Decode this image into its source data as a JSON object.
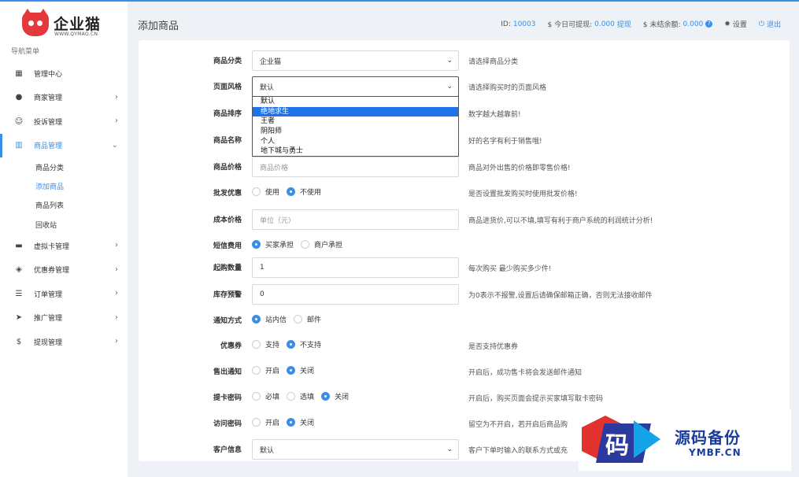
{
  "logo": {
    "name": "企业猫",
    "sub": "WWW.QYMAO.CN"
  },
  "nav": {
    "title": "导航菜单",
    "items": [
      {
        "label": "管理中心",
        "icon": "dashboard-icon",
        "chev": ""
      },
      {
        "label": "商家管理",
        "icon": "user-icon",
        "chev": "›"
      },
      {
        "label": "投诉管理",
        "icon": "face-icon",
        "chev": "›"
      },
      {
        "label": "商品管理",
        "icon": "shop-icon",
        "chev": "⌄"
      },
      {
        "label": "虚拟卡管理",
        "icon": "card-icon",
        "chev": "›"
      },
      {
        "label": "优惠券管理",
        "icon": "tag-icon",
        "chev": "›"
      },
      {
        "label": "订单管理",
        "icon": "list-icon",
        "chev": "›"
      },
      {
        "label": "推广管理",
        "icon": "send-icon",
        "chev": "›"
      },
      {
        "label": "提现管理",
        "icon": "dollar-icon",
        "chev": "›"
      }
    ],
    "sub_items": [
      "商品分类",
      "添加商品",
      "商品列表",
      "回收站"
    ]
  },
  "header": {
    "title": "添加商品",
    "id_label": "ID:",
    "id_value": "10003",
    "withdraw_label": "$ 今日可提现:",
    "withdraw_value": "0.000",
    "withdraw_link": "提现",
    "unsettled_label": "$ 未结余额:",
    "unsettled_value": "0.000",
    "settings": "设置",
    "logout": "退出"
  },
  "form": {
    "category": {
      "label": "商品分类",
      "value": "企业猫",
      "hint": "请选择商品分类"
    },
    "style": {
      "label": "页面风格",
      "value": "默认",
      "hint": "请选择购买时的页面风格",
      "options": [
        "默认",
        "绝地求生",
        "王者",
        "阴阳师",
        "个人",
        "地下城与勇士"
      ],
      "highlighted": "绝地求生"
    },
    "sort": {
      "label": "商品排序",
      "hint": "数字越大越靠前!"
    },
    "name": {
      "label": "商品名称",
      "hint": "好的名字有利于销售哦!"
    },
    "price": {
      "label": "商品价格",
      "placeholder": "商品价格",
      "hint": "商品对外出售的价格即零售价格!"
    },
    "wholesale": {
      "label": "批发优惠",
      "options": [
        "使用",
        "不使用"
      ],
      "selected": "不使用",
      "hint": "是否设置批发购买时使用批发价格!"
    },
    "cost": {
      "label": "成本价格",
      "placeholder": "单位（元）",
      "hint": "商品进货价,可以不填,填写有利于商户系统的利润统计分析!"
    },
    "sms": {
      "label": "短信费用",
      "options": [
        "买家承担",
        "商户承担"
      ],
      "selected": "买家承担"
    },
    "min_qty": {
      "label": "起购数量",
      "value": "1",
      "hint": "每次购买 最少购买多少件!"
    },
    "stock_alert": {
      "label": "库存预警",
      "value": "0",
      "hint": "为0表示不报警,设置后请确保邮箱正确，否则无法接收邮件"
    },
    "notify": {
      "label": "通知方式",
      "options": [
        "站内信",
        "邮件"
      ],
      "selected": "站内信"
    },
    "coupon": {
      "label": "优惠券",
      "options": [
        "支持",
        "不支持"
      ],
      "selected": "不支持",
      "hint": "是否支持优惠券"
    },
    "sold_notify": {
      "label": "售出通知",
      "options": [
        "开启",
        "关闭"
      ],
      "selected": "关闭",
      "hint": "开启后，成功售卡将会发送邮件通知"
    },
    "card_pwd": {
      "label": "提卡密码",
      "options": [
        "必填",
        "选填",
        "关闭"
      ],
      "selected": "关闭",
      "hint": "开启后，购买页面会提示买家填写取卡密码"
    },
    "access_pwd": {
      "label": "访问密码",
      "options": [
        "开启",
        "关闭"
      ],
      "selected": "关闭",
      "hint": "留空为不开启，若开启后商品购"
    },
    "customer": {
      "label": "客户信息",
      "value": "默认",
      "hint": "客户下单时输入的联系方式或充"
    }
  },
  "watermark": {
    "char": "码",
    "cn": "源码备份",
    "en": "YMBF.CN"
  },
  "colors": {
    "accent": "#3a8ee6",
    "highlight": "#1e73e8",
    "background": "#eef1f5"
  }
}
